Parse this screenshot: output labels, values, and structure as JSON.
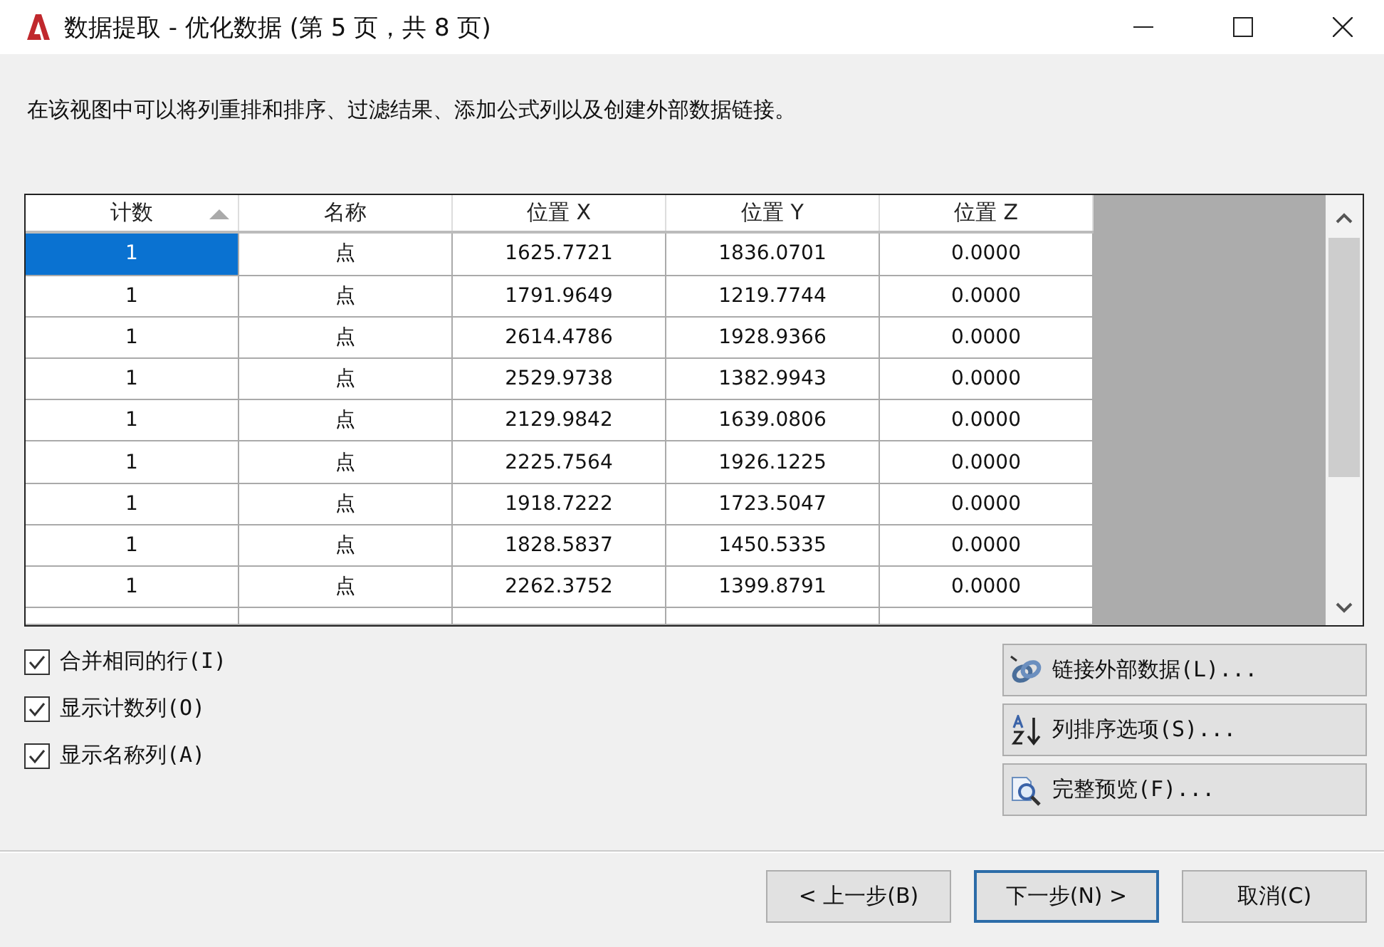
{
  "window": {
    "title": "数据提取 - 优化数据 (第 5 页，共 8 页)"
  },
  "description": "在该视图中可以将列重排和排序、过滤结果、添加公式列以及创建外部数据链接。",
  "table": {
    "columns": [
      {
        "label": "计数",
        "sorted": true
      },
      {
        "label": "名称",
        "sorted": false
      },
      {
        "label": "位置 X",
        "sorted": false
      },
      {
        "label": "位置 Y",
        "sorted": false
      },
      {
        "label": "位置 Z",
        "sorted": false
      }
    ],
    "rows": [
      {
        "selected": true,
        "cells": [
          "1",
          "点",
          "1625.7721",
          "1836.0701",
          "0.0000"
        ]
      },
      {
        "selected": false,
        "cells": [
          "1",
          "点",
          "1791.9649",
          "1219.7744",
          "0.0000"
        ]
      },
      {
        "selected": false,
        "cells": [
          "1",
          "点",
          "2614.4786",
          "1928.9366",
          "0.0000"
        ]
      },
      {
        "selected": false,
        "cells": [
          "1",
          "点",
          "2529.9738",
          "1382.9943",
          "0.0000"
        ]
      },
      {
        "selected": false,
        "cells": [
          "1",
          "点",
          "2129.9842",
          "1639.0806",
          "0.0000"
        ]
      },
      {
        "selected": false,
        "cells": [
          "1",
          "点",
          "2225.7564",
          "1926.1225",
          "0.0000"
        ]
      },
      {
        "selected": false,
        "cells": [
          "1",
          "点",
          "1918.7222",
          "1723.5047",
          "0.0000"
        ]
      },
      {
        "selected": false,
        "cells": [
          "1",
          "点",
          "1828.5837",
          "1450.5335",
          "0.0000"
        ]
      },
      {
        "selected": false,
        "cells": [
          "1",
          "点",
          "2262.3752",
          "1399.8791",
          "0.0000"
        ]
      }
    ]
  },
  "options": [
    {
      "label": "合并相同的行(I)",
      "checked": true
    },
    {
      "label": "显示计数列(O)",
      "checked": true
    },
    {
      "label": "显示名称列(A)",
      "checked": true
    }
  ],
  "side_buttons": [
    {
      "kind": "link",
      "label": "链接外部数据(L)..."
    },
    {
      "kind": "sort",
      "label": "列排序选项(S)..."
    },
    {
      "kind": "preview",
      "label": "完整预览(F)..."
    }
  ],
  "buttons": [
    {
      "label": "< 上一步(B)",
      "default": false
    },
    {
      "label": "下一步(N) >",
      "default": true
    },
    {
      "label": "取消(C)",
      "default": false
    }
  ]
}
